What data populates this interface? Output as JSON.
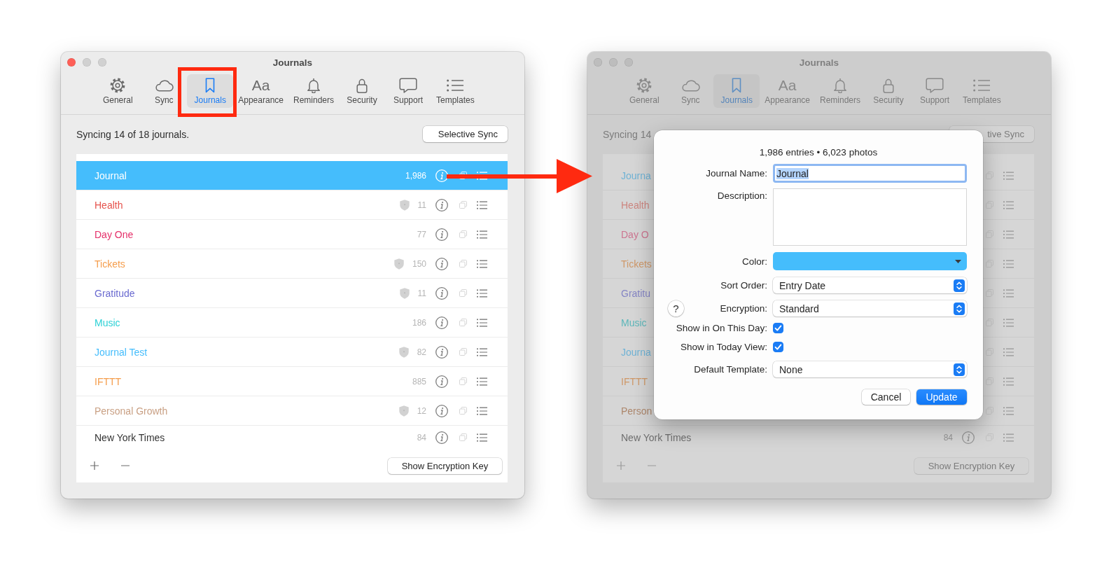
{
  "windows": [
    {
      "title": "Journals",
      "active": true,
      "tabs": [
        {
          "label": "General",
          "selected": false
        },
        {
          "label": "Sync",
          "selected": false
        },
        {
          "label": "Journals",
          "selected": true
        },
        {
          "label": "Appearance",
          "selected": false,
          "glyph": "Aa"
        },
        {
          "label": "Reminders",
          "selected": false
        },
        {
          "label": "Security",
          "selected": false
        },
        {
          "label": "Support",
          "selected": false
        },
        {
          "label": "Templates",
          "selected": false
        }
      ],
      "sync_status": "Syncing 14 of 18 journals.",
      "sync_button": "Selective Sync",
      "journals": [
        {
          "name": "Journal",
          "color": "#45bdfc",
          "count": "1,986",
          "encrypted": false,
          "selected": true
        },
        {
          "name": "Health",
          "color": "#e6534d",
          "count": "11",
          "encrypted": true,
          "selected": false
        },
        {
          "name": "Day One",
          "color": "#e5306a",
          "count": "77",
          "encrypted": false,
          "selected": false
        },
        {
          "name": "Tickets",
          "color": "#f59d4c",
          "count": "150",
          "encrypted": true,
          "selected": false
        },
        {
          "name": "Gratitude",
          "color": "#6a6ad0",
          "count": "11",
          "encrypted": true,
          "selected": false
        },
        {
          "name": "Music",
          "color": "#2cd1d6",
          "count": "186",
          "encrypted": false,
          "selected": false
        },
        {
          "name": "Journal Test",
          "color": "#45bdfc",
          "count": "82",
          "encrypted": true,
          "selected": false
        },
        {
          "name": "IFTTT",
          "color": "#f59d4c",
          "count": "885",
          "encrypted": false,
          "selected": false
        },
        {
          "name": "Personal Growth",
          "color": "#c9a084",
          "count": "12",
          "encrypted": true,
          "selected": false
        },
        {
          "name": "New York Times",
          "color": "#333333",
          "count": "84",
          "encrypted": false,
          "selected": false
        }
      ],
      "encryption_key_button": "Show Encryption Key"
    },
    {
      "title": "Journals",
      "active": false,
      "tabs": [
        {
          "label": "General",
          "selected": false
        },
        {
          "label": "Sync",
          "selected": false
        },
        {
          "label": "Journals",
          "selected": true
        },
        {
          "label": "Appearance",
          "selected": false,
          "glyph": "Aa"
        },
        {
          "label": "Reminders",
          "selected": false
        },
        {
          "label": "Security",
          "selected": false
        },
        {
          "label": "Support",
          "selected": false
        },
        {
          "label": "Templates",
          "selected": false
        }
      ],
      "sync_status": "Syncing 14",
      "sync_button": "tive Sync",
      "journals": [
        {
          "name": "Journa",
          "color": "#6fb3d6",
          "selected": false
        },
        {
          "name": "Health",
          "color": "#cd8680",
          "selected": false
        },
        {
          "name": "Day O",
          "color": "#cc7590",
          "selected": false
        },
        {
          "name": "Tickets",
          "color": "#cf9868",
          "selected": false
        },
        {
          "name": "Gratitu",
          "color": "#8585c4",
          "selected": false
        },
        {
          "name": "Music",
          "color": "#5cb7ba",
          "selected": false
        },
        {
          "name": "Journa",
          "color": "#6fb3d6",
          "selected": false
        },
        {
          "name": "IFTTT",
          "color": "#cf9868",
          "selected": false
        },
        {
          "name": "Person",
          "color": "#ad876c",
          "selected": false
        },
        {
          "name": "New York Times",
          "color": "#6f6f6f",
          "count": "84",
          "selected": false
        }
      ],
      "encryption_key_button": "Show Encryption Key",
      "sheet": {
        "summary": "1,986 entries • 6,023 photos",
        "fields": [
          {
            "kind": "text",
            "label": "Journal Name:",
            "value": "Journal",
            "focused": true
          },
          {
            "kind": "textarea",
            "label": "Description:"
          },
          {
            "kind": "color",
            "label": "Color:",
            "color": "#45bdfc"
          },
          {
            "kind": "popup",
            "label": "Sort Order:",
            "value": "Entry Date"
          },
          {
            "kind": "popup",
            "label": "Encryption:",
            "value": "Standard",
            "help": "?"
          },
          {
            "kind": "checkbox",
            "label": "Show in On This Day:",
            "checked": true
          },
          {
            "kind": "checkbox",
            "label": "Show in Today View:",
            "checked": true
          },
          {
            "kind": "popup",
            "label": "Default Template:",
            "value": "None"
          }
        ],
        "buttons": [
          {
            "label": "Cancel",
            "default": false
          },
          {
            "label": "Update",
            "default": true
          }
        ]
      }
    }
  ]
}
